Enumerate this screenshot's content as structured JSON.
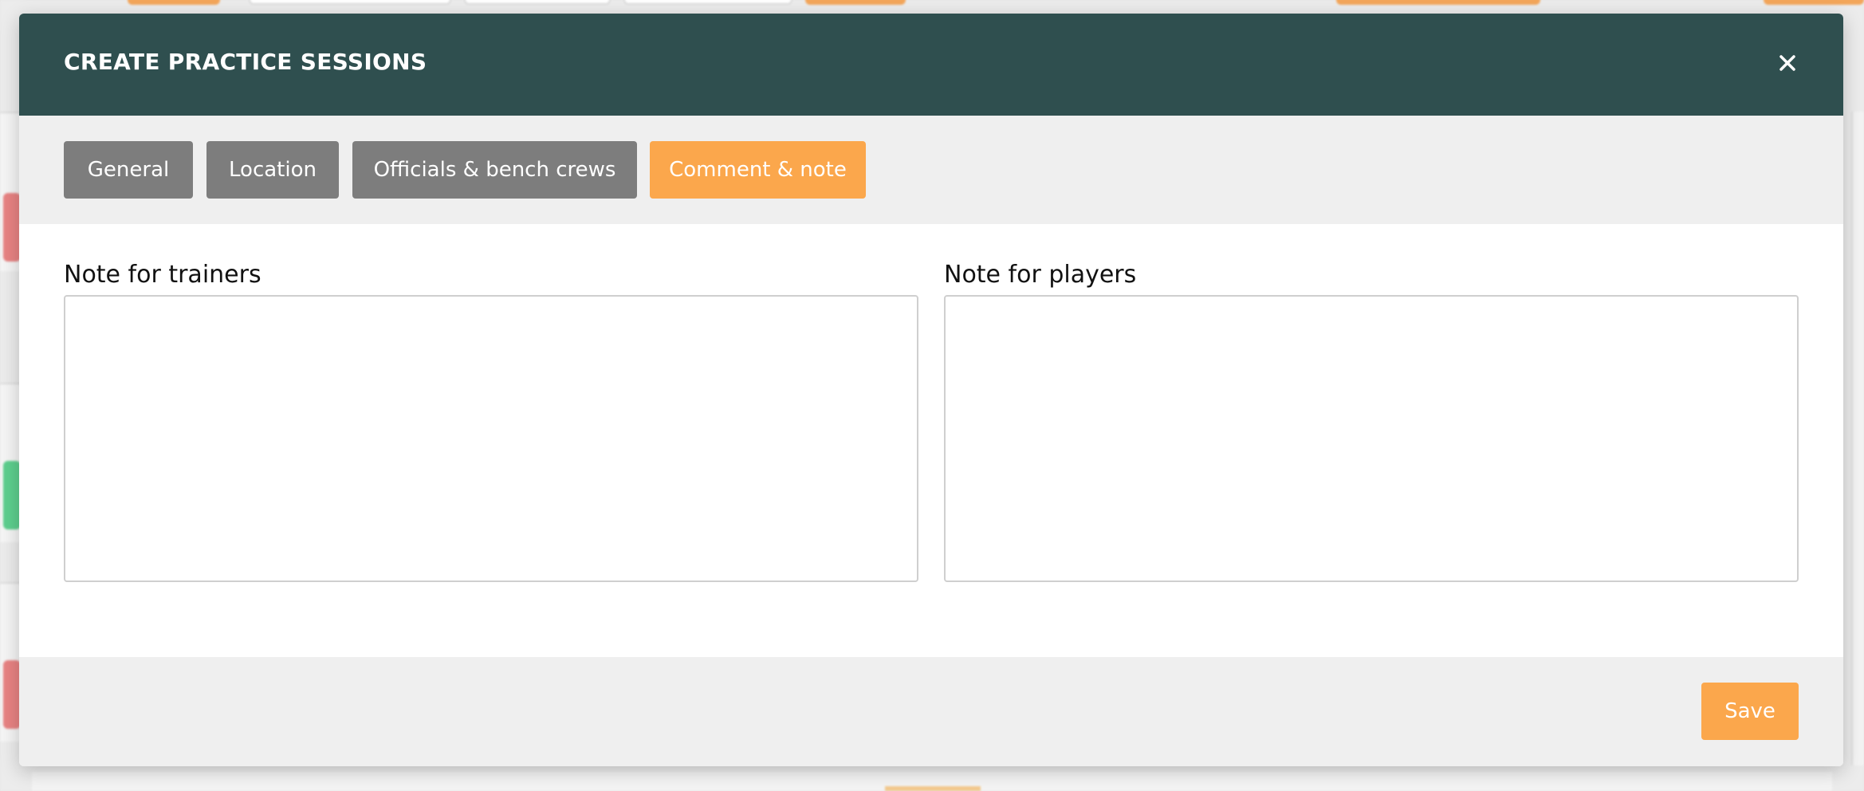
{
  "modal": {
    "title": "CREATE PRACTICE SESSIONS",
    "close_icon": "close-icon"
  },
  "tabs": [
    {
      "label": "General",
      "active": false
    },
    {
      "label": "Location",
      "active": false
    },
    {
      "label": "Officials & bench crews",
      "active": false
    },
    {
      "label": "Comment & note",
      "active": true
    }
  ],
  "fields": {
    "trainers": {
      "label": "Note for trainers",
      "value": ""
    },
    "players": {
      "label": "Note for players",
      "value": ""
    }
  },
  "footer": {
    "save_label": "Save"
  },
  "colors": {
    "header_bg": "#2f4f4f",
    "accent": "#fba74c",
    "tab_inactive": "#7d7d7d",
    "panel_bg": "#efefef"
  }
}
